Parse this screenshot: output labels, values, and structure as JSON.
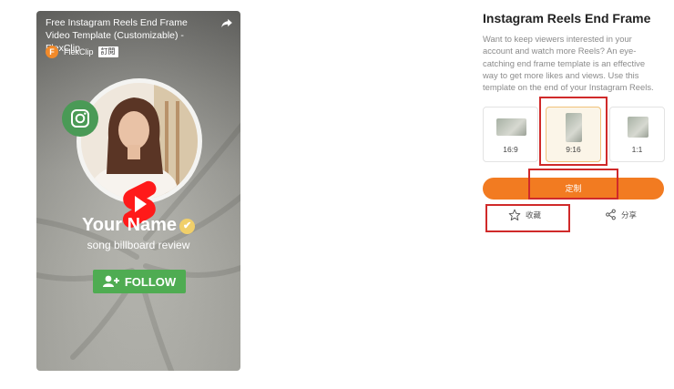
{
  "video": {
    "title": "Free Instagram Reels End Frame Video Template (Customizable) - FlexClip",
    "channel_initial": "F",
    "channel_name": "FlexClip",
    "subscribe_label": "訂閱",
    "your_name": "Your Name",
    "subtitle": "song billboard review",
    "follow_label": "FOLLOW",
    "icons": [
      "share-arrow-icon",
      "instagram-icon",
      "youtube-shorts-icon",
      "verified-check-icon",
      "add-user-icon"
    ]
  },
  "panel": {
    "title": "Instagram Reels End Frame",
    "description": "Want to keep viewers interested in your account and watch more Reels? An eye-catching end frame template is an effective way to get more likes and views. Use this template on the end of your Instagram Reels.",
    "ratios": [
      {
        "label": "16:9",
        "selected": false
      },
      {
        "label": "9:16",
        "selected": true
      },
      {
        "label": "1:1",
        "selected": false
      }
    ],
    "customize_label": "定制",
    "favorite_label": "收藏",
    "share_label": "分享"
  },
  "colors": {
    "accent": "#f27b21",
    "highlight": "#d02a2a",
    "follow_green": "#4fac52",
    "insta_green": "#4a9a56"
  }
}
